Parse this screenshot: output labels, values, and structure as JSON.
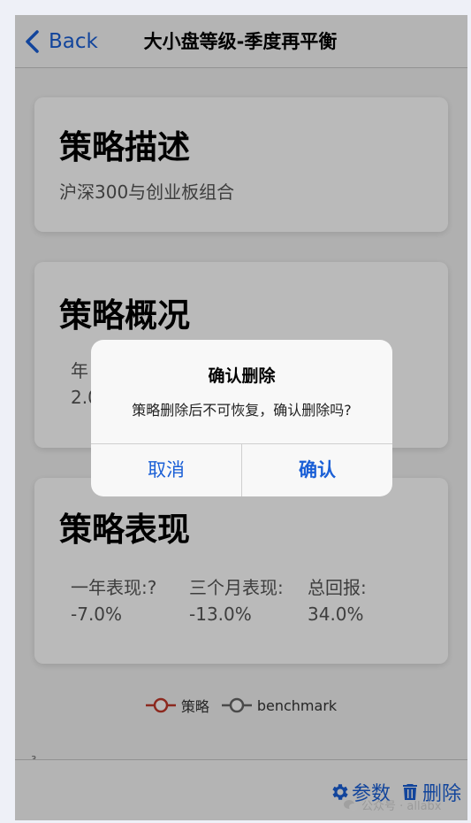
{
  "nav": {
    "back_label": "Back",
    "title": "大小盘等级-季度再平衡"
  },
  "description_card": {
    "heading": "策略描述",
    "text": "沪深300与创业板组合"
  },
  "overview_card": {
    "heading": "策略概况",
    "stat_1": "年",
    "stat_2": "2.0"
  },
  "performance_card": {
    "heading": "策略表现",
    "stats": [
      {
        "label": "一年表现:?",
        "value": "-7.0%"
      },
      {
        "label": "三个月表现:",
        "value": "-13.0%"
      },
      {
        "label": "总回报:",
        "value": "34.0%"
      }
    ]
  },
  "legend": {
    "strategy": "策略",
    "benchmark": "benchmark"
  },
  "axis_tick": "3",
  "toolbar": {
    "params_label": "参数",
    "delete_label": "删除"
  },
  "dialog": {
    "title": "确认删除",
    "message": "策略删除后不可恢复，确认删除吗?",
    "cancel_label": "取消",
    "confirm_label": "确认"
  },
  "watermark": "公众号 · allabx",
  "colors": {
    "accent": "#1a5fd6",
    "strategy_line": "#c0392b",
    "benchmark_line": "#666666"
  }
}
